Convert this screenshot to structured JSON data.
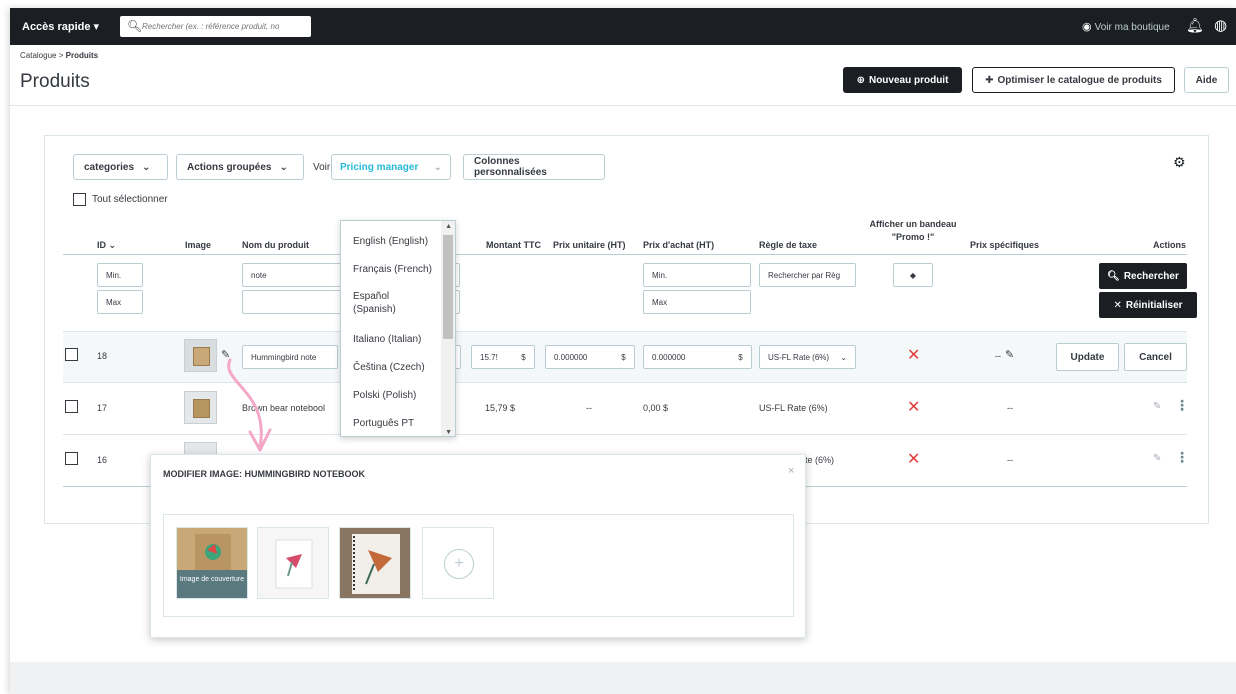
{
  "topbar": {
    "quick_access": "Accès rapide ▾",
    "search_placeholder": "Rechercher (ex. : référence produit, no",
    "view_shop": "Voir ma boutique"
  },
  "breadcrumb": {
    "parent": "Catalogue",
    "sep": ">",
    "current": "Produits"
  },
  "page_title": "Produits",
  "header_buttons": {
    "new_product": "Nouveau produit",
    "optimize": "Optimiser le catalogue de produits",
    "help": "Aide"
  },
  "toolbar": {
    "categories": "categories",
    "bulk_actions": "Actions groupées",
    "view_label": "Voir",
    "view_value": "Pricing manager",
    "custom_columns": "Colonnes personnalisées",
    "select_all": "Tout sélectionner"
  },
  "columns": {
    "id": "ID",
    "image": "Image",
    "name": "Nom du produit",
    "price_ttc": "Montant TTC",
    "unit_price": "Prix unitaire (HT)",
    "purchase_price": "Prix d'achat (HT)",
    "tax_rule": "Règle de taxe",
    "promo_line1": "Afficher un bandeau",
    "promo_line2": "\"Promo !\"",
    "specific_prices": "Prix spécifiques",
    "actions": "Actions"
  },
  "filters": {
    "id_min": "Min.",
    "id_max": "Max",
    "name_value": "note",
    "purchase_min": "Min.",
    "purchase_max": "Max",
    "tax_placeholder": "Rechercher par Règ",
    "promo_select": "◆",
    "search_btn": "Rechercher",
    "reset_btn": "Réinitialiser"
  },
  "rows": [
    {
      "id": "18",
      "name": "Hummingbird note",
      "price_ttc": "15.7!",
      "currency": "$",
      "unit_price": "0.000000",
      "purchase_price": "0.000000",
      "tax_rule": "US-FL Rate (6%)",
      "specific": "--",
      "update": "Update",
      "cancel": "Cancel"
    },
    {
      "id": "17",
      "name": "Brown bear notebool",
      "price_ttc": "15,79 $",
      "unit_price": "--",
      "purchase_price": "0,00 $",
      "tax_rule": "US-FL Rate (6%)",
      "specific": "--"
    },
    {
      "id": "16",
      "tax_rule": "te (6%)",
      "specific": "--"
    }
  ],
  "languages": [
    "English (English)",
    "Français (French)",
    "Español (Spanish)",
    "Italiano (Italian)",
    "Čeština (Czech)",
    "Polski (Polish)",
    "Português PT"
  ],
  "modal": {
    "title": "MODIFIER IMAGE: HUMMINGBIRD NOTEBOOK",
    "close": "×",
    "cover_label": "Image de couverture"
  },
  "colors": {
    "topbar": "#1b1f24",
    "accent": "#25b9d7",
    "danger": "#e33d3d",
    "arrow": "#f2a8c6"
  }
}
